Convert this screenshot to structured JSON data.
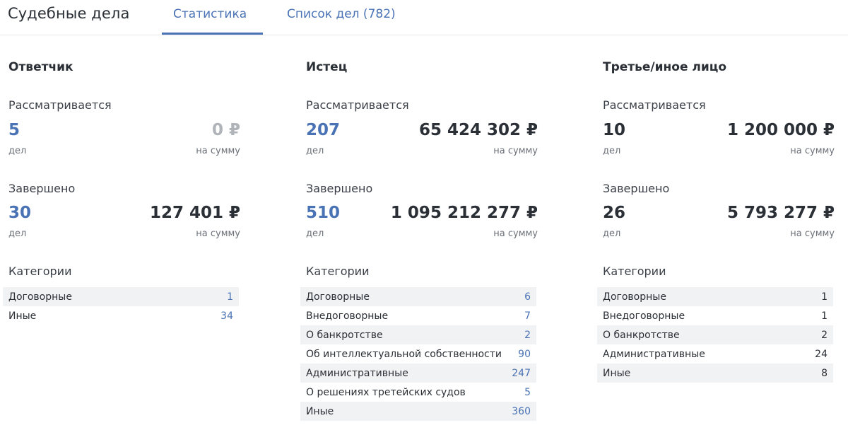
{
  "header": {
    "title": "Судебные дела",
    "tabs": [
      {
        "label": "Статистика",
        "active": true
      },
      {
        "label": "Список дел (782)",
        "active": false
      }
    ]
  },
  "colors": {
    "accent": "#4a73b5",
    "text": "#2b2f36",
    "muted": "#b0b3b8"
  },
  "columns": [
    {
      "title": "Ответчик",
      "pending": {
        "label": "Рассматривается",
        "count": "5",
        "count_unit": "дел",
        "sum": "0 ₽",
        "sum_unit": "на сумму",
        "sum_muted": true,
        "count_accent": true
      },
      "completed": {
        "label": "Завершено",
        "count": "30",
        "count_unit": "дел",
        "sum": "127 401 ₽",
        "sum_unit": "на сумму",
        "count_accent": true
      },
      "categories_label": "Категории",
      "categories_accent": true,
      "categories": [
        {
          "name": "Договорные",
          "value": "1"
        },
        {
          "name": "Иные",
          "value": "34"
        }
      ]
    },
    {
      "title": "Истец",
      "pending": {
        "label": "Рассматривается",
        "count": "207",
        "count_unit": "дел",
        "sum": "65 424 302 ₽",
        "sum_unit": "на сумму",
        "count_accent": true
      },
      "completed": {
        "label": "Завершено",
        "count": "510",
        "count_unit": "дел",
        "sum": "1 095 212 277 ₽",
        "sum_unit": "на сумму",
        "count_accent": true
      },
      "categories_label": "Категории",
      "categories_accent": true,
      "categories": [
        {
          "name": "Договорные",
          "value": "6"
        },
        {
          "name": "Внедоговорные",
          "value": "7"
        },
        {
          "name": "О банкротстве",
          "value": "2"
        },
        {
          "name": "Об интеллектуальной собственности",
          "value": "90"
        },
        {
          "name": "Административные",
          "value": "247"
        },
        {
          "name": "О решениях третейских судов",
          "value": "5"
        },
        {
          "name": "Иные",
          "value": "360"
        }
      ]
    },
    {
      "title": "Третье/иное лицо",
      "pending": {
        "label": "Рассматривается",
        "count": "10",
        "count_unit": "дел",
        "sum": "1 200 000 ₽",
        "sum_unit": "на сумму",
        "count_accent": false
      },
      "completed": {
        "label": "Завершено",
        "count": "26",
        "count_unit": "дел",
        "sum": "5 793 277 ₽",
        "sum_unit": "на сумму",
        "count_accent": false
      },
      "categories_label": "Категории",
      "categories_accent": false,
      "categories": [
        {
          "name": "Договорные",
          "value": "1"
        },
        {
          "name": "Внедоговорные",
          "value": "1"
        },
        {
          "name": "О банкротстве",
          "value": "2"
        },
        {
          "name": "Административные",
          "value": "24"
        },
        {
          "name": "Иные",
          "value": "8"
        }
      ]
    }
  ]
}
